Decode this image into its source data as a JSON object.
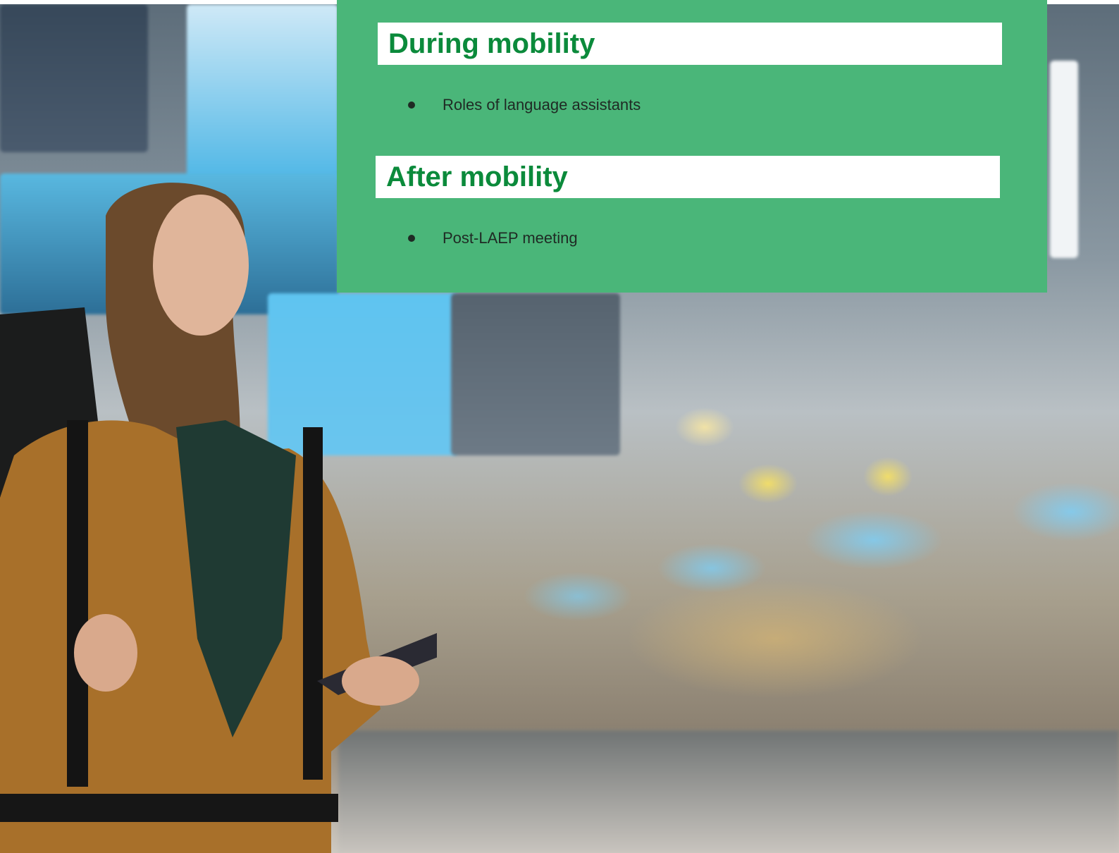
{
  "slide": {
    "background_image": "airport-traveler-photo",
    "panel_color": "#4ab679",
    "heading_color": "#0b8a3b"
  },
  "sections": [
    {
      "heading": "During mobility",
      "bullets": [
        "Roles of language assistants"
      ]
    },
    {
      "heading": "After mobility",
      "bullets": [
        "Post-LAEP meeting"
      ]
    }
  ],
  "icons": {
    "bullet": "bullet-dot-icon"
  }
}
